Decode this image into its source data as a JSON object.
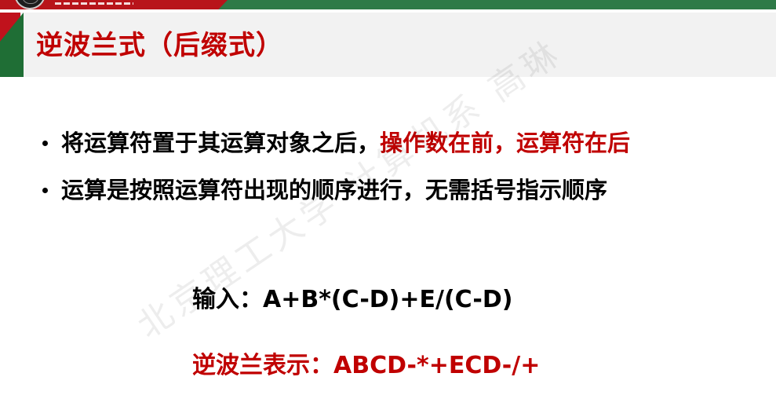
{
  "header": {
    "title": "逆波兰式（后缀式）"
  },
  "bullets": [
    {
      "text": "将运算符置于其运算对象之后，",
      "highlight": "操作数在前，运算符在后"
    },
    {
      "text": "运算是按照运算符出现的顺序进行，无需括号指示顺序",
      "highlight": ""
    }
  ],
  "example": {
    "input": "输入：A+B*(C-D)+E/(C-D)",
    "rpn": "逆波兰表示：ABCD-*+ECD-/+"
  },
  "watermark": "北京理工大学 计算机系 高琳",
  "colors": {
    "accent_red": "#c00000",
    "brand_green": "#2e7a47",
    "brand_red": "#b8141a"
  }
}
